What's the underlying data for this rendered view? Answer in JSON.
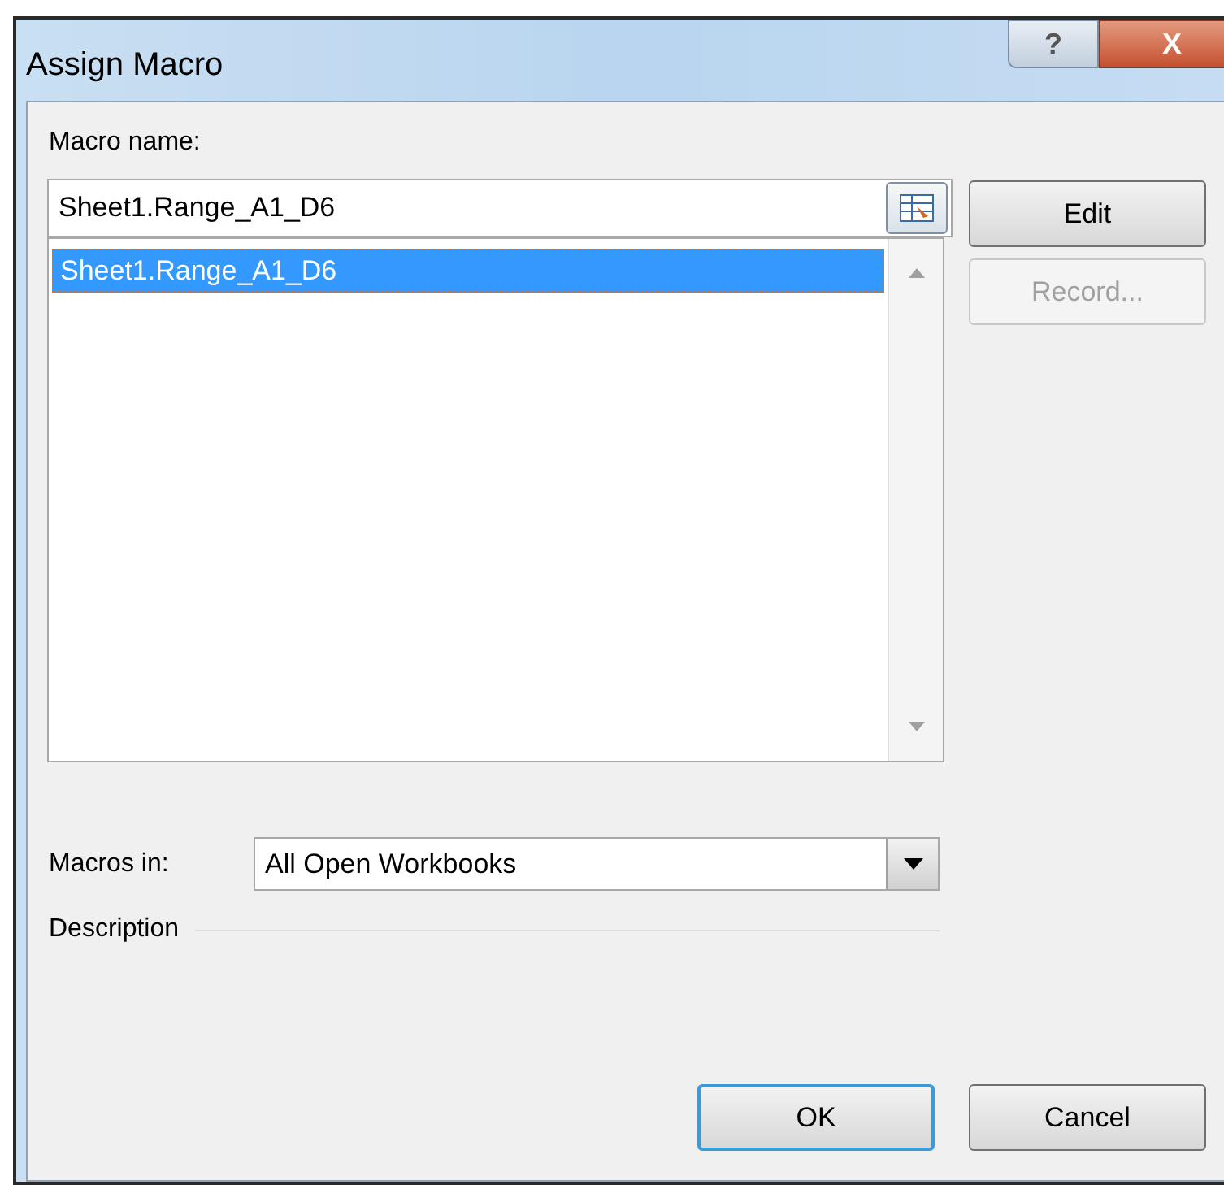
{
  "window": {
    "title": "Assign Macro",
    "title_buttons": [
      "?",
      "X"
    ]
  },
  "macro_name": {
    "label": "Macro name:",
    "value": "Sheet1.Range_A1_D6"
  },
  "macros": [
    {
      "name": "Sheet1.Range_A1_D6",
      "selected": true
    }
  ],
  "buttons": [
    {
      "label": "Edit",
      "disabled": false
    },
    {
      "label": "Record...",
      "disabled": true
    }
  ],
  "macros_in": {
    "label": "Macros in:",
    "value": "All Open Workbooks"
  },
  "description": {
    "label": "Description"
  },
  "footer_buttons": [
    {
      "label": "OK",
      "default": true
    },
    {
      "label": "Cancel",
      "default": false
    }
  ]
}
